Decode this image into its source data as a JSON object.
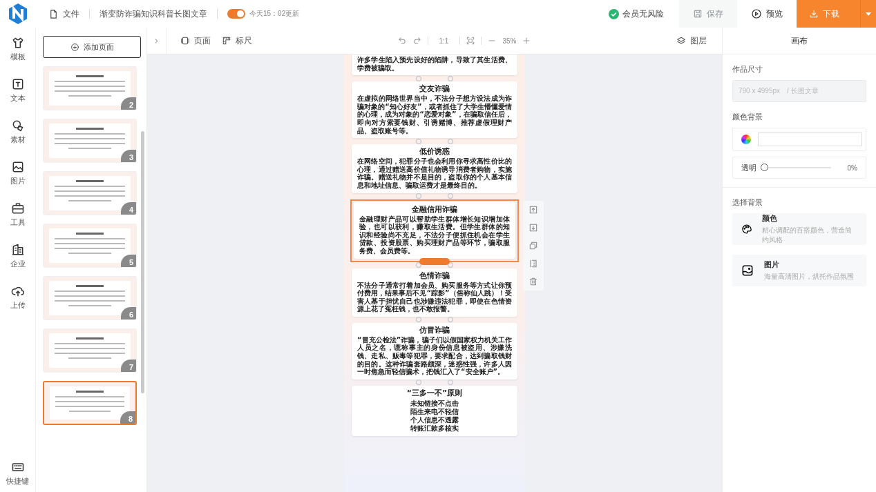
{
  "topbar": {
    "file_menu": "文件",
    "doc_title": "渐变防诈骗知识科普长图文章",
    "autosave": {
      "on": true,
      "label": "今天15：02更新"
    },
    "member_status": "会员无风险",
    "save": {
      "label": "保存",
      "disabled": true
    },
    "preview": {
      "label": "预览"
    },
    "download": {
      "label": "下载"
    }
  },
  "rail": {
    "items": [
      {
        "label": "模板",
        "kind": "template"
      },
      {
        "label": "文本",
        "kind": "text"
      },
      {
        "label": "素材",
        "kind": "material"
      },
      {
        "label": "图片",
        "kind": "image"
      },
      {
        "label": "工具",
        "kind": "tools"
      },
      {
        "label": "企业",
        "kind": "company"
      },
      {
        "label": "上传",
        "kind": "upload"
      }
    ],
    "shortcut": "快捷键"
  },
  "pages": {
    "add_label": "添加页面",
    "items": [
      {
        "number": "2",
        "selected": false
      },
      {
        "number": "3",
        "selected": false
      },
      {
        "number": "4",
        "selected": false
      },
      {
        "number": "5",
        "selected": false
      },
      {
        "number": "6",
        "selected": false
      },
      {
        "number": "7",
        "selected": false
      },
      {
        "number": "8",
        "selected": true
      }
    ]
  },
  "toolbar": {
    "page": "页面",
    "ruler": "标尺",
    "zoom_reset": "1:1",
    "zoom": "35%",
    "layers": "图层"
  },
  "canvas": {
    "cards": [
      {
        "kind": "partial",
        "selected": false,
        "body": "许多学生陷入预先设好的陷阱，导致了其生活费、学费被骗取。"
      },
      {
        "kind": "text",
        "selected": false,
        "title": "交友诈骗",
        "body": "在虚拟的网络世界当中，不法分子想方设法成为诈骗对象的“知心好友”，或者抓住了大学生懵懂爱情的心理，成为对象的“恋爱对象”，在骗取信任后，即向对方索要钱财、引诱赌博、推荐虚假理财产品、盗取账号等。"
      },
      {
        "kind": "text",
        "selected": false,
        "title": "低价诱惑",
        "body": "在网络空间，犯罪分子也会利用你寻求高性价比的心理，通过赠送高价值礼物诱导消费者购物，实施诈骗。赠送礼物并不是目的，盗取你的个人基本信息和地址信息、骗取运费才是最终目的。"
      },
      {
        "kind": "text",
        "selected": true,
        "title": "金融信用诈骗",
        "body": "金融理财产品可以帮助学生群体增长知识增加体验，也可以获利，赚取生活费。但学生群体的知识和经验尚不充足，不法分子便抓住机会在学生贷款、投资股票、购买理财产品等环节，骗取服务费、会员费等。"
      },
      {
        "kind": "text",
        "selected": false,
        "title": "色情诈骗",
        "body": "不法分子通常打着加会员、购买服务等方式让你预付费用，结果事后不见“踪影”（俗称仙人跳）！受害人基于担忧自己也涉嫌违法犯罪，即使在色情资源上花了冤枉钱，也不敢报警。"
      },
      {
        "kind": "text",
        "selected": false,
        "title": "仿冒诈骗",
        "body": "“冒充公检法”诈骗，骗子们以假国家权力机关工作人员之名，谎称事主的身份信息被盗用、涉嫌洗钱、走私、贩毒等犯罪，要求配合，达到骗取钱财的目的。这种诈骗套路颇深，迷惑性强，许多人因一时焦急而轻信骗术，把钱汇入了“安全账户”。"
      },
      {
        "kind": "list",
        "selected": false,
        "title": "“三多一不”原则",
        "lines": [
          "未知链接不点击",
          "陌生来电不轻信",
          "个人信息不透露",
          "转账汇款多核实"
        ]
      }
    ]
  },
  "panel": {
    "title": "画布",
    "size_label": "作品尺寸",
    "size_value": "790 x 4995px　/ 长图文章",
    "color_label": "颜色背景",
    "opacity": {
      "label": "透明",
      "level": 0,
      "reading": "0%"
    },
    "bg_label": "选择背景",
    "options": [
      {
        "kind": "color",
        "title": "颜色",
        "desc": "精心调配的百搭颜色，营造简约风格"
      },
      {
        "kind": "image",
        "title": "图片",
        "desc": "海量高清图片，烘托作品氛围"
      }
    ]
  }
}
